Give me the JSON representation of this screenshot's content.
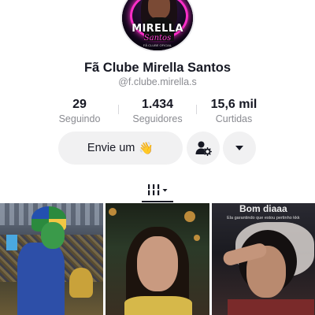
{
  "profile": {
    "avatar_logo_title": "MIRELLA",
    "avatar_logo_subtitle": "Santos",
    "avatar_logo_tiny": "FÃ CLUBE OFICIAL",
    "display_name": "Fã Clube Mirella Santos",
    "username": "@f.clube.mirella.s"
  },
  "stats": [
    {
      "value": "29",
      "label": "Seguindo"
    },
    {
      "value": "1.434",
      "label": "Seguidores"
    },
    {
      "value": "15,6 mil",
      "label": "Curtidas"
    }
  ],
  "actions": {
    "message_label": "Envie um",
    "message_emoji": "👋",
    "add_friend_icon": "user-gear-icon",
    "dropdown_icon": "caret-down-icon"
  },
  "tabs": {
    "videos_icon": "grid-bars-icon"
  },
  "videos": [
    {
      "caption": ""
    },
    {
      "caption": ""
    },
    {
      "caption": "Bom diaaa",
      "subcaption": "Ela garantindo que estou pertinho kkk"
    }
  ],
  "colors": {
    "text": "#161823",
    "muted": "#8a8b91",
    "button_bg": "#f1f1f2",
    "accent_logo": "#ff2ec9"
  }
}
